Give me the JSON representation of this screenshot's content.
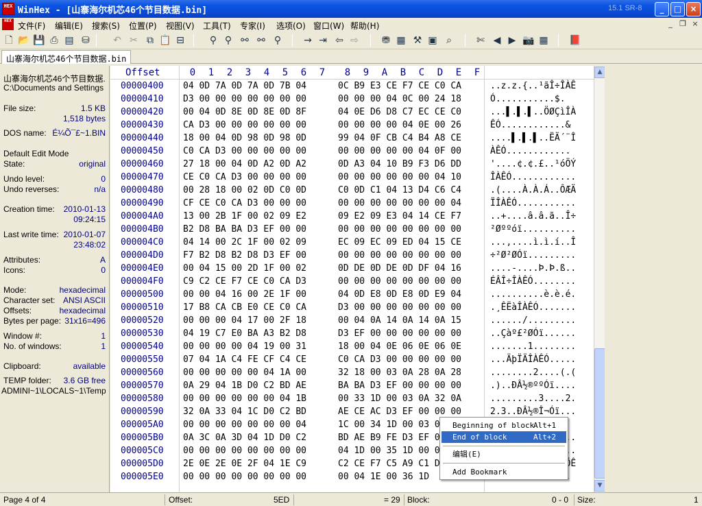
{
  "window": {
    "title": "WinHex - [山寨海尔机芯46个节目数据.bin]",
    "logo_text": "HEX",
    "version": "15.1 SR-8",
    "minimize": "_",
    "maximize": "□",
    "close": "×"
  },
  "menu": {
    "items": [
      "文件(F)",
      "编辑(E)",
      "搜索(S)",
      "位置(P)",
      "视图(V)",
      "工具(T)",
      "专家(I)",
      "选项(O)",
      "窗口(W)",
      "帮助(H)"
    ],
    "mdi_min": "_",
    "mdi_restore": "❐",
    "mdi_close": "×"
  },
  "toolbar": {
    "icons": [
      "new-file-icon",
      "open-icon",
      "save-icon",
      "print-icon",
      "properties-icon",
      "open-disk-icon",
      "undo-icon",
      "cut-icon",
      "copy-icon",
      "paste-icon",
      "write-icon",
      "find-icon",
      "find-hex-icon",
      "replace-icon",
      "replace-hex-icon",
      "find-next-icon",
      "goto-offset-icon",
      "goto-page-icon",
      "back-icon",
      "forward-icon",
      "disk-editor-icon",
      "ram-editor-icon",
      "tools-icon",
      "calculator-icon",
      "search-icon",
      "scissor-icon",
      "prev-icon",
      "next-icon",
      "camera-icon",
      "table-icon",
      "help-icon"
    ]
  },
  "tab": {
    "label": "山寨海尔机芯46个节目数据.bin"
  },
  "info": {
    "file_name": "山寨海尔机芯46个节目数据.",
    "file_path": "C:\\Documents and Settings",
    "file_size_label": "File size:",
    "file_size_kb": "1.5 KB",
    "file_size_bytes": "1,518 bytes",
    "dos_name_label": "DOS name:",
    "dos_name": "É¼Õ¯£~1.BIN",
    "edit_mode_label": "Default Edit Mode",
    "state_label": "State:",
    "state": "original",
    "undo_level_label": "Undo level:",
    "undo_level": "0",
    "undo_reverses_label": "Undo reverses:",
    "undo_reverses": "n/a",
    "creation_label": "Creation time:",
    "creation_date": "2010-01-13",
    "creation_time": "09:24:15",
    "lastwrite_label": "Last write time:",
    "lastwrite_date": "2010-01-07",
    "lastwrite_time": "23:48:02",
    "attributes_label": "Attributes:",
    "attributes": "A",
    "icons_label": "Icons:",
    "icons": "0",
    "mode_label": "Mode:",
    "mode": "hexadecimal",
    "charset_label": "Character set:",
    "charset": "ANSI ASCII",
    "offsets_label": "Offsets:",
    "offsets": "hexadecimal",
    "bpp_label": "Bytes per page:",
    "bpp": "31x16=496",
    "window_no_label": "Window #:",
    "window_no": "1",
    "num_windows_label": "No. of windows:",
    "num_windows": "1",
    "clipboard_label": "Clipboard:",
    "clipboard": "available",
    "temp_label": "TEMP folder:",
    "temp_free": "3.6 GB free",
    "temp_path": "ADMINI~1\\LOCALS~1\\Temp"
  },
  "hex": {
    "offset_header": "Offset",
    "columns": [
      "0",
      "1",
      "2",
      "3",
      "4",
      "5",
      "6",
      "7",
      "8",
      "9",
      "A",
      "B",
      "C",
      "D",
      "E",
      "F"
    ],
    "rows": [
      {
        "off": "00000400",
        "h1": "04 0D 7A 0D 7A 0D 7B 04",
        "h2": "0C B9 E3 CE F7 CE C0 CA",
        "asc": "..z.z.{..¹ãÎ÷ÎÀÊ"
      },
      {
        "off": "00000410",
        "h1": "D3 00 00 00 00 00 00 00",
        "h2": "00 00 00 04 0C 00 24 18",
        "asc": "Ó...........$."
      },
      {
        "off": "00000420",
        "h1": "00 04 0D 8E 0D 8E 0D 8F",
        "h2": "04 0E D6 D8 C7 EC CE C0",
        "asc": "...▌.▌.▌..ÖØÇìÎÀ"
      },
      {
        "off": "00000430",
        "h1": "CA D3 00 00 00 00 00 00",
        "h2": "00 00 00 00 04 0E 00 26",
        "asc": "ÊÓ............&"
      },
      {
        "off": "00000440",
        "h1": "18 00 04 0D 98 0D 98 0D",
        "h2": "99 04 0F CB C4 B4 A8 CE",
        "asc": "....▌.▌.▌..ËÄ´¨Î"
      },
      {
        "off": "00000450",
        "h1": "C0 CA D3 00 00 00 00 00",
        "h2": "00 00 00 00 00 04 0F 00",
        "asc": "ÀÊÓ............"
      },
      {
        "off": "00000460",
        "h1": "27 18 00 04 0D A2 0D A2",
        "h2": "0D A3 04 10 B9 F3 D6 DD",
        "asc": "'....¢.¢.£..¹óÖÝ"
      },
      {
        "off": "00000470",
        "h1": "CE C0 CA D3 00 00 00 00",
        "h2": "00 00 00 00 00 00 04 10",
        "asc": "ÎÀÊÓ............"
      },
      {
        "off": "00000480",
        "h1": "00 28 18 00 02 0D C0 0D",
        "h2": "C0 0D C1 04 13 D4 C6 C4",
        "asc": ".(....À.À.Á..ÔÆÄ"
      },
      {
        "off": "00000490",
        "h1": "CF CE C0 CA D3 00 00 00",
        "h2": "00 00 00 00 00 00 00 04",
        "asc": "ÏÎÀÊÓ..........."
      },
      {
        "off": "000004A0",
        "h1": "13 00 2B 1F 00 02 09 E2",
        "h2": "09 E2 09 E3 04 14 CE F7",
        "asc": "..+....â.â.ã..Î÷"
      },
      {
        "off": "000004B0",
        "h1": "B2 D8 BA BA D3 EF 00 00",
        "h2": "00 00 00 00 00 00 00 00",
        "asc": "²Øººóï.........."
      },
      {
        "off": "000004C0",
        "h1": "04 14 00 2C 1F 00 02 09",
        "h2": "EC 09 EC 09 ED 04 15 CE",
        "asc": "...,....ì.ì.í..Î"
      },
      {
        "off": "000004D0",
        "h1": "F7 B2 D8 B2 D8 D3 EF 00",
        "h2": "00 00 00 00 00 00 00 00",
        "asc": "÷²Ø²ØÓï........."
      },
      {
        "off": "000004E0",
        "h1": "00 04 15 00 2D 1F 00 02",
        "h2": "0D DE 0D DE 0D DF 04 16",
        "asc": "....-....Þ.Þ.ß.."
      },
      {
        "off": "000004F0",
        "h1": "C9 C2 CE F7 CE C0 CA D3",
        "h2": "00 00 00 00 00 00 00 00",
        "asc": "ÉÂÎ÷ÎÀÊÓ........"
      },
      {
        "off": "00000500",
        "h1": "00 00 04 16 00 2E 1F 00",
        "h2": "04 0D E8 0D E8 0D E9 04",
        "asc": "..........è.è.é."
      },
      {
        "off": "00000510",
        "h1": "17 B8 CA CB E0 CE C0 CA",
        "h2": "D3 00 00 00 00 00 00 00",
        "asc": ".¸ÊËàÎÀÊÓ......."
      },
      {
        "off": "00000520",
        "h1": "00 00 00 04 17 00 2F 18",
        "h2": "00 04 0A 14 0A 14 0A 15",
        "asc": "....../........."
      },
      {
        "off": "00000530",
        "h1": "04 19 C7 E0 BA A3 B2 D8",
        "h2": "D3 EF 00 00 00 00 00 00",
        "asc": "..Çàº£²ØÓï......"
      },
      {
        "off": "00000540",
        "h1": "00 00 00 00 04 19 00 31",
        "h2": "18 00 04 0E 06 0E 06 0E",
        "asc": ".......1........"
      },
      {
        "off": "00000550",
        "h1": "07 04 1A C4 FE CF C4 CE",
        "h2": "C0 CA D3 00 00 00 00 00",
        "asc": "...ÄþÏÄÎÀÊÓ....."
      },
      {
        "off": "00000560",
        "h1": "00 00 00 00 00 04 1A 00",
        "h2": "32 18 00 03 0A 28 0A 28",
        "asc": "........2....(.("
      },
      {
        "off": "00000570",
        "h1": "0A 29 04 1B D0 C2 BD AE",
        "h2": "BA BA D3 EF 00 00 00 00",
        "asc": ".)..ÐÂ½®ººÓï...."
      },
      {
        "off": "00000580",
        "h1": "00 00 00 00 00 00 04 1B",
        "h2": "00 33 1D 00 03 0A 32 0A",
        "asc": ".........3....2."
      },
      {
        "off": "00000590",
        "h1": "32 0A 33 04 1C D0 C2 BD",
        "h2": "AE CE AC D3 EF 00 00 00",
        "asc": "2.3..ÐÂ½®Î¬Óï..."
      },
      {
        "off": "000005A0",
        "h1": "00 00 00 00 00 00 00 04",
        "h2": "1C 00 34 1D 00 03 0A 3C",
        "asc": "........4....<"
      },
      {
        "off": "000005B0",
        "h1": "0A 3C 0A 3D 04 1D D0 C2",
        "h2": "BD AE B9 FE D3 EF 00 00",
        "asc": ".<.=..ÐÂ½®¹þÓï.."
      },
      {
        "off": "000005C0",
        "h1": "00 00 00 00 00 00 00 00",
        "h2": "04 1D 00 35 1D 00 03 0A",
        "asc": "........5......."
      },
      {
        "off": "000005D0",
        "h1": "2E 0E 2E 0E 2F 04 1E C9",
        "h2": "C2 CE F7 C5 A9 C1 D6 CA",
        "asc": "..../..ÉÂÎ÷Å©ÁÖÊ"
      },
      {
        "off": "000005E0",
        "h1": "00 00 00 00 00 00 00 00",
        "h2": "00 04 1E 00 36 1D",
        "asc": "..............."
      }
    ]
  },
  "context_menu": {
    "begin_block": "Beginning of block",
    "begin_shortcut": "Alt+1",
    "end_block": "End of block",
    "end_shortcut": "Alt+2",
    "edit": "编辑(E)",
    "add_bookmark": "Add Bookmark"
  },
  "status": {
    "page": "Page 4 of 4",
    "offset_label": "Offset:",
    "offset_value": "5ED",
    "eq_value": "= 29",
    "block_label": "Block:",
    "block_value": "0 - 0",
    "size_label": "Size:",
    "size_value": "1"
  }
}
